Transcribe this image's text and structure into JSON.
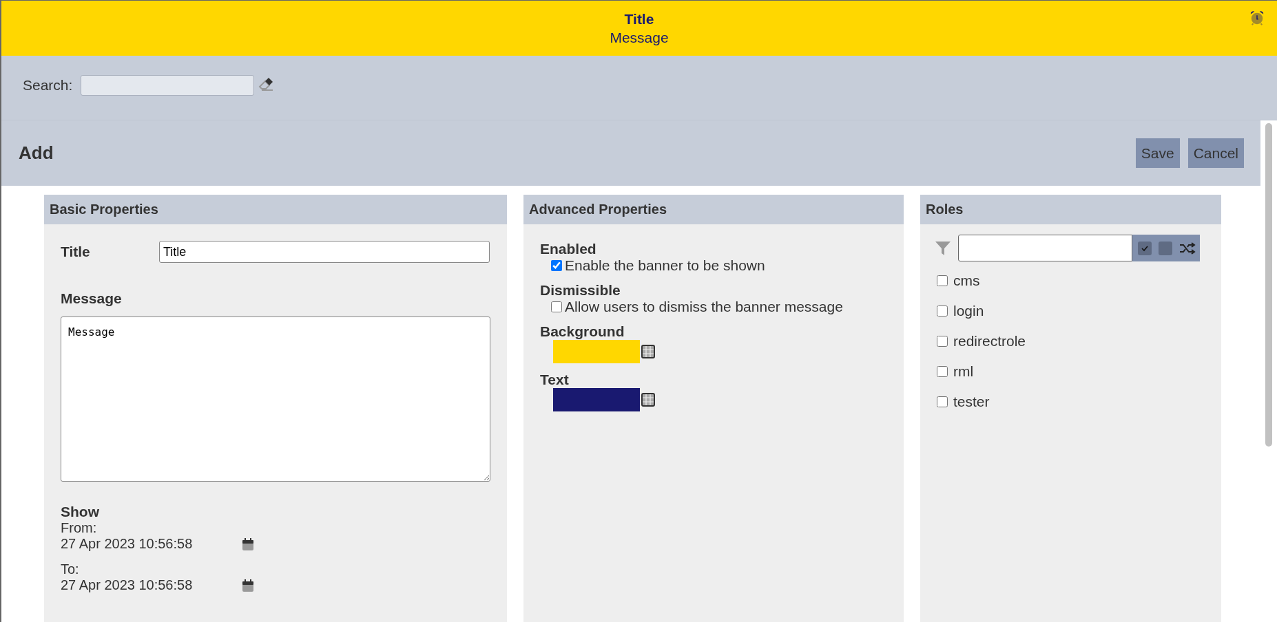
{
  "banner": {
    "title": "Title",
    "message": "Message"
  },
  "search": {
    "label": "Search:"
  },
  "form": {
    "heading": "Add",
    "buttons": [
      "Save",
      "Cancel"
    ]
  },
  "basic": {
    "heading": "Basic Properties",
    "title_label": "Title",
    "title_value": "Title",
    "message_label": "Message",
    "message_value": "Message",
    "show_label": "Show",
    "from_label": "From:",
    "from_value": "27 Apr 2023 10:56:58",
    "to_label": "To:",
    "to_value": "27 Apr 2023 10:56:58"
  },
  "advanced": {
    "heading": "Advanced Properties",
    "options": [
      {
        "label": "Enabled",
        "description": "Enable the banner to be shown",
        "checked": true
      },
      {
        "label": "Dismissible",
        "description": "Allow users to dismiss the banner message",
        "checked": false
      }
    ],
    "colors": [
      {
        "label": "Background",
        "color": "#ffd700"
      },
      {
        "label": "Text",
        "color": "#191970"
      }
    ]
  },
  "roles": {
    "heading": "Roles",
    "items": [
      {
        "label": "cms",
        "checked": false
      },
      {
        "label": "login",
        "checked": false
      },
      {
        "label": "redirectrole",
        "checked": false
      },
      {
        "label": "rml",
        "checked": false
      },
      {
        "label": "tester",
        "checked": false
      }
    ]
  }
}
